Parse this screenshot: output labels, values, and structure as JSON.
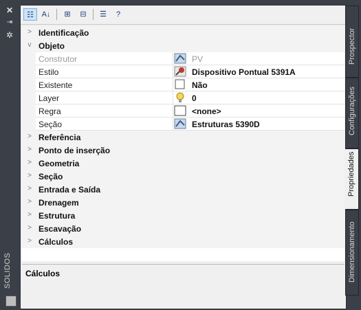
{
  "left": {
    "panel_title": "SOLIDOS"
  },
  "grid": {
    "categories_before": [
      {
        "label": "Identificação",
        "expanded": false
      },
      {
        "label": "Objeto",
        "expanded": true
      }
    ],
    "properties": [
      {
        "name": "Construtor",
        "value": "PV",
        "disabled": true,
        "icon": "pipe-network-icon"
      },
      {
        "name": "Estilo",
        "value": "Dispositivo Pontual 5391A",
        "disabled": false,
        "icon": "structure-style-icon"
      },
      {
        "name": "Existente",
        "value": "Não",
        "disabled": false,
        "icon": "checkbox-icon"
      },
      {
        "name": "Layer",
        "value": "0",
        "disabled": false,
        "icon": "lightbulb-icon"
      },
      {
        "name": "Regra",
        "value": "<none>",
        "disabled": false,
        "icon": "blank-swatch-icon"
      },
      {
        "name": "Seção",
        "value": "Estruturas 5390D",
        "disabled": false,
        "icon": "pipe-network-icon"
      }
    ],
    "categories_after": [
      {
        "label": "Referência"
      },
      {
        "label": "Ponto de inserção"
      },
      {
        "label": "Geometria"
      },
      {
        "label": "Seção"
      },
      {
        "label": "Entrada e Saída"
      },
      {
        "label": "Drenagem"
      },
      {
        "label": "Estrutura"
      },
      {
        "label": "Escavação"
      },
      {
        "label": "Cálculos"
      }
    ]
  },
  "description": {
    "title": "Cálculos"
  },
  "tabs": [
    {
      "label": "Prospector",
      "active": false
    },
    {
      "label": "Configurações",
      "active": false
    },
    {
      "label": "Propriedades",
      "active": true
    },
    {
      "label": "Dimensionamento",
      "active": false
    }
  ],
  "colors": {
    "dark_chrome": "#3b3f47",
    "panel_bg": "#f0f0f0",
    "grid_bg": "#ffffff",
    "selection": "#cde3f7"
  }
}
